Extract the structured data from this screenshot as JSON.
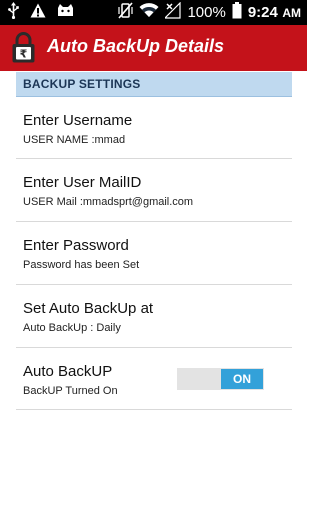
{
  "status_bar": {
    "battery_percent": "100%",
    "time": "9:24",
    "time_suffix": "AM"
  },
  "app": {
    "title": "Auto BackUp Details",
    "accent_color": "#c4121a",
    "icon": "lock-rupee-icon"
  },
  "section": {
    "header": "BACKUP SETTINGS"
  },
  "prefs": [
    {
      "title": "Enter Username",
      "summary": "USER NAME :mmad"
    },
    {
      "title": "Enter User MailID",
      "summary": "USER Mail :mmadsprt@gmail.com"
    },
    {
      "title": "Enter Password",
      "summary": "Password has been Set"
    },
    {
      "title": "Set Auto BackUp at",
      "summary": "Auto BackUp : Daily"
    },
    {
      "title": "Auto BackUP",
      "summary": "BackUP Turned On",
      "toggle_label": "ON",
      "toggle_state": "on"
    }
  ]
}
